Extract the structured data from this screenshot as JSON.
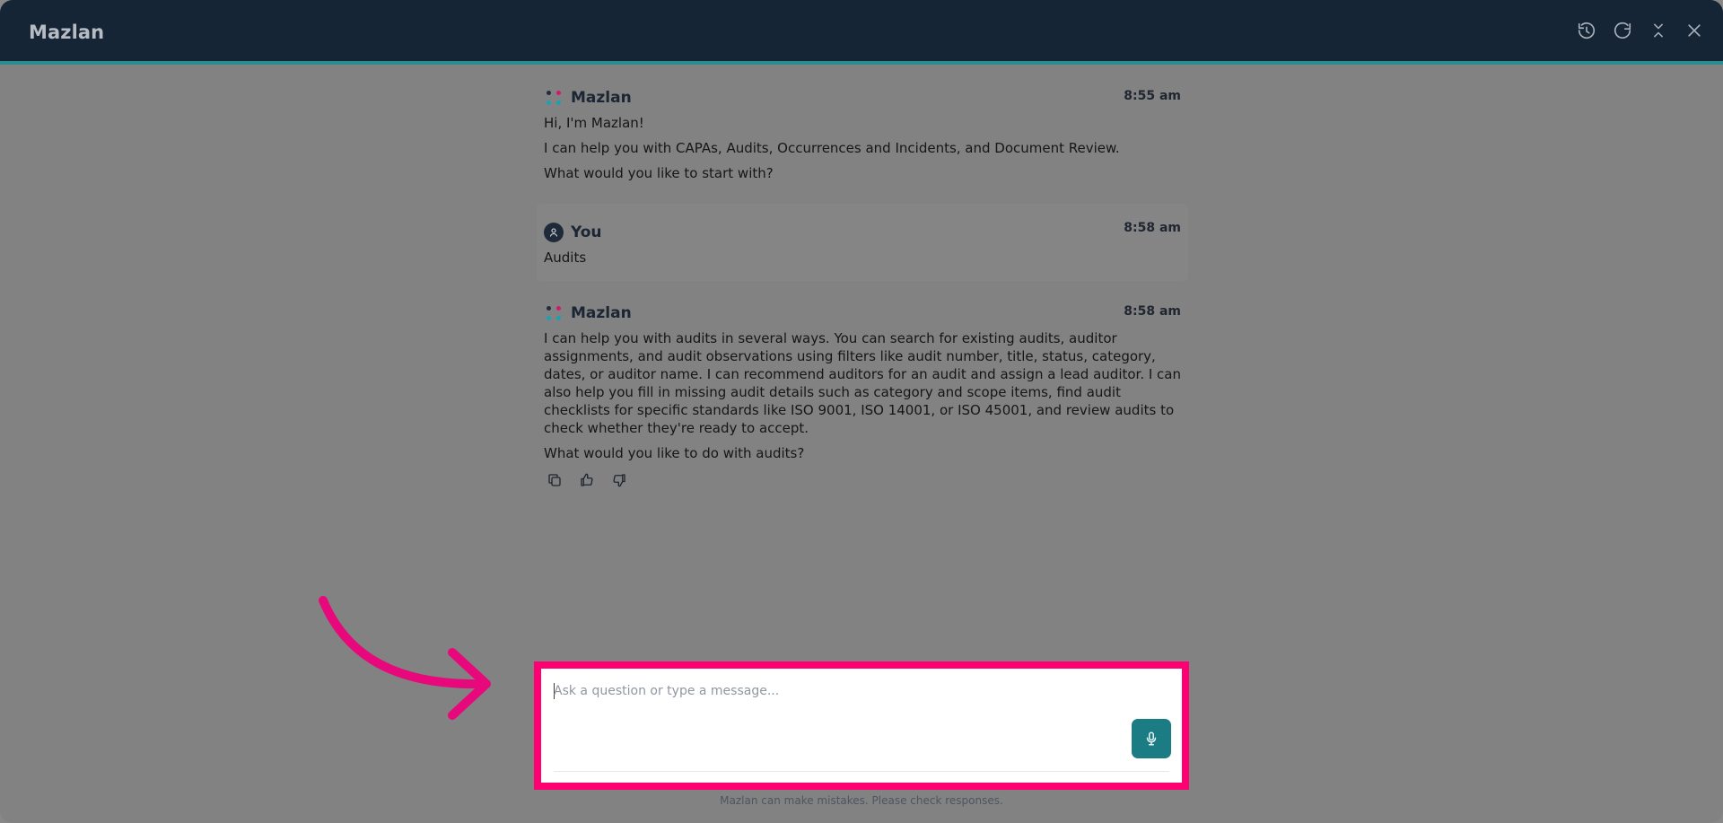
{
  "app": {
    "title": "Mazlan"
  },
  "window_controls": [
    {
      "name": "history-icon"
    },
    {
      "name": "refresh-icon"
    },
    {
      "name": "collapse-icon"
    },
    {
      "name": "close-icon"
    }
  ],
  "messages": [
    {
      "sender": "Mazlan",
      "time": "8:55 am",
      "paragraphs": [
        "Hi, I'm Mazlan!",
        "I can help you with CAPAs, Audits, Occurrences and Incidents, and Document Review.",
        "What would you like to start with?"
      ]
    },
    {
      "sender": "You",
      "time": "8:58 am",
      "paragraphs": [
        "Audits"
      ]
    },
    {
      "sender": "Mazlan",
      "time": "8:58 am",
      "paragraphs": [
        "I can help you with audits in several ways. You can search for existing audits, auditor assignments, and audit observations using filters like audit number, title, status, category, dates, or auditor name. I can recommend auditors for an audit and assign a lead auditor. I can also help you fill in missing audit details such as category and scope items, find audit checklists for specific standards like ISO 9001, ISO 14001, or ISO 45001, and review audits to check whether they're ready to accept.",
        "What would you like to do with audits?"
      ],
      "actions": [
        {
          "name": "copy-icon"
        },
        {
          "name": "thumbs-up-icon"
        },
        {
          "name": "thumbs-down-icon"
        }
      ]
    }
  ],
  "composer": {
    "placeholder": "Ask a question or type a message...",
    "value": "",
    "mic_icon": "microphone-icon"
  },
  "footer": {
    "disclaimer": "Mazlan can make mistakes. Please check responses."
  },
  "annotation": {
    "highlight_color": "#ff0072",
    "arrow_icon": "arrow-annotation"
  }
}
